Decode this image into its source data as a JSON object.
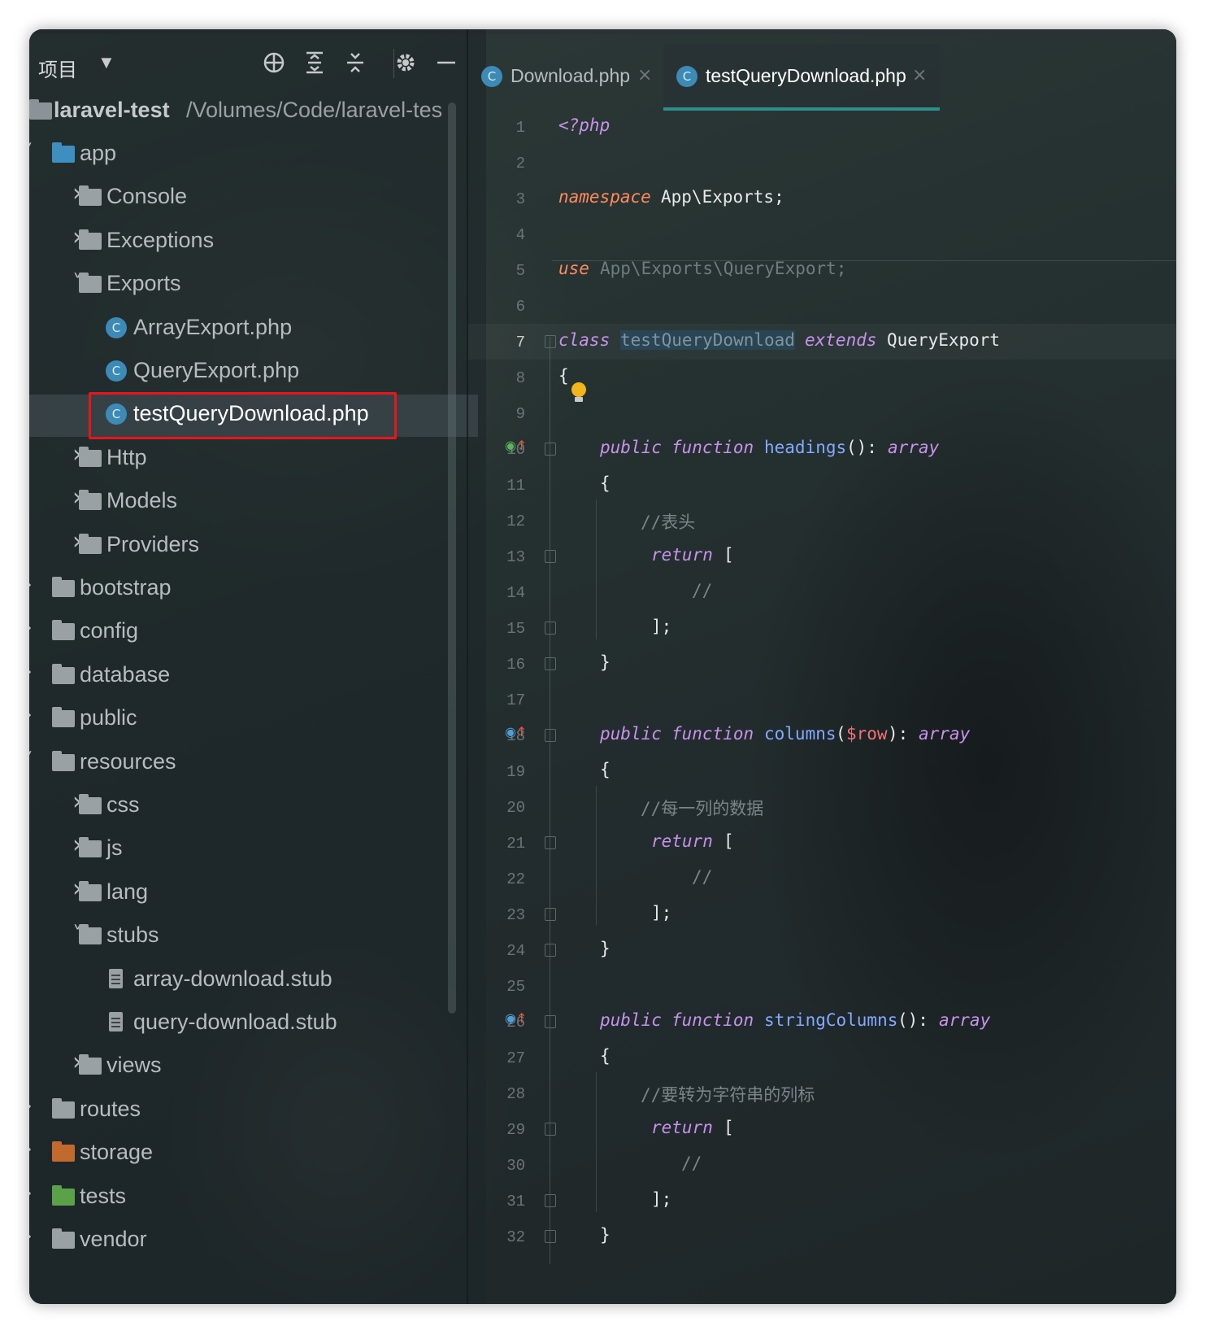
{
  "sidebar": {
    "title": "项目",
    "root": {
      "name": "laravel-test",
      "path": "/Volumes/Code/laravel-tes"
    },
    "items": [
      {
        "label": "app",
        "depth": 1,
        "expanded": true,
        "kind": "folder"
      },
      {
        "label": "Console",
        "depth": 2,
        "expanded": false,
        "kind": "folder"
      },
      {
        "label": "Exceptions",
        "depth": 2,
        "expanded": false,
        "kind": "folder"
      },
      {
        "label": "Exports",
        "depth": 2,
        "expanded": true,
        "kind": "folder"
      },
      {
        "label": "ArrayExport.php",
        "depth": 3,
        "kind": "php"
      },
      {
        "label": "QueryExport.php",
        "depth": 3,
        "kind": "php"
      },
      {
        "label": "testQueryDownload.php",
        "depth": 3,
        "kind": "php",
        "selected": true
      },
      {
        "label": "Http",
        "depth": 2,
        "expanded": false,
        "kind": "folder"
      },
      {
        "label": "Models",
        "depth": 2,
        "expanded": false,
        "kind": "folder"
      },
      {
        "label": "Providers",
        "depth": 2,
        "expanded": false,
        "kind": "folder"
      },
      {
        "label": "bootstrap",
        "depth": 1,
        "expanded": false,
        "kind": "folder"
      },
      {
        "label": "config",
        "depth": 1,
        "expanded": false,
        "kind": "folder"
      },
      {
        "label": "database",
        "depth": 1,
        "expanded": false,
        "kind": "folder"
      },
      {
        "label": "public",
        "depth": 1,
        "expanded": false,
        "kind": "folder"
      },
      {
        "label": "resources",
        "depth": 1,
        "expanded": true,
        "kind": "folder"
      },
      {
        "label": "css",
        "depth": 2,
        "expanded": false,
        "kind": "folder"
      },
      {
        "label": "js",
        "depth": 2,
        "expanded": false,
        "kind": "folder"
      },
      {
        "label": "lang",
        "depth": 2,
        "expanded": false,
        "kind": "folder"
      },
      {
        "label": "stubs",
        "depth": 2,
        "expanded": true,
        "kind": "folder"
      },
      {
        "label": "array-download.stub",
        "depth": 3,
        "kind": "stub"
      },
      {
        "label": "query-download.stub",
        "depth": 3,
        "kind": "stub"
      },
      {
        "label": "views",
        "depth": 2,
        "expanded": false,
        "kind": "folder"
      },
      {
        "label": "routes",
        "depth": 1,
        "expanded": false,
        "kind": "folder"
      },
      {
        "label": "storage",
        "depth": 1,
        "expanded": false,
        "kind": "folder-orange"
      },
      {
        "label": "tests",
        "depth": 1,
        "expanded": false,
        "kind": "folder-green"
      },
      {
        "label": "vendor",
        "depth": 1,
        "expanded": false,
        "kind": "folder"
      }
    ]
  },
  "tabs": [
    {
      "label": "Download.php",
      "active": false
    },
    {
      "label": "testQueryDownload.php",
      "active": true
    }
  ],
  "editor": {
    "lines": [
      {
        "n": "1"
      },
      {
        "n": "2"
      },
      {
        "n": "3"
      },
      {
        "n": "4"
      },
      {
        "n": "5"
      },
      {
        "n": "6"
      },
      {
        "n": "7"
      },
      {
        "n": "8"
      },
      {
        "n": "9"
      },
      {
        "n": "10"
      },
      {
        "n": "11"
      },
      {
        "n": "12"
      },
      {
        "n": "13"
      },
      {
        "n": "14"
      },
      {
        "n": "15"
      },
      {
        "n": "16"
      },
      {
        "n": "17"
      },
      {
        "n": "18"
      },
      {
        "n": "19"
      },
      {
        "n": "20"
      },
      {
        "n": "21"
      },
      {
        "n": "22"
      },
      {
        "n": "23"
      },
      {
        "n": "24"
      },
      {
        "n": "25"
      },
      {
        "n": "26"
      },
      {
        "n": "27"
      },
      {
        "n": "28"
      },
      {
        "n": "29"
      },
      {
        "n": "30"
      },
      {
        "n": "31"
      },
      {
        "n": "32"
      }
    ],
    "code": {
      "php_open": "<?php",
      "ns_kw": "namespace",
      "ns_name": "App\\Exports;",
      "use_kw": "use",
      "use_name": "App\\Exports\\QueryExport;",
      "class_kw": "class",
      "class_name": "testQueryDownload",
      "extends_kw": "extends",
      "parent": "QueryExport",
      "open_brace": "{",
      "close_brace": "}",
      "public": "public",
      "function": "function",
      "fn1": "headings",
      "fn1_args": "():",
      "fn2": "columns",
      "fn2_open": "(",
      "fn2_param": "$row",
      "fn2_close": "):",
      "fn3": "stringColumns",
      "fn3_args": "():",
      "ret_type": "array",
      "comment1": "//表头",
      "comment2": "//每一列的数据",
      "comment3": "//要转为字符串的列标",
      "return_kw": "return",
      "bracket_open": "[",
      "empty_comment": "//",
      "bracket_close": "];"
    }
  },
  "colors": {
    "accent": "#2f8e8a",
    "selection_box": "#e8151c",
    "php_icon": "#3c8ab5"
  },
  "icons": [
    "locate-icon",
    "expand-all-icon",
    "collapse-all-icon",
    "gear-icon",
    "minimize-icon",
    "chevron-down-icon",
    "folder-icon",
    "php-class-icon",
    "stub-file-icon",
    "close-icon",
    "bulb-icon",
    "override-icon"
  ]
}
